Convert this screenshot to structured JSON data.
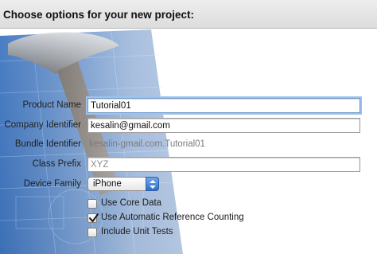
{
  "header": {
    "title": "Choose options for your new project:"
  },
  "form": {
    "product_name": {
      "label": "Product Name",
      "value": "Tutorial01"
    },
    "company_identifier": {
      "label": "Company Identifier",
      "value": "kesalin@gmail.com"
    },
    "bundle_identifier": {
      "label": "Bundle Identifier",
      "value": "kesalin-gmail.com.Tutorial01"
    },
    "class_prefix": {
      "label": "Class Prefix",
      "value": "XYZ"
    },
    "device_family": {
      "label": "Device Family",
      "selected": "iPhone"
    },
    "checkboxes": [
      {
        "label": "Use Core Data",
        "checked": false
      },
      {
        "label": "Use Automatic Reference Counting",
        "checked": true
      },
      {
        "label": "Include Unit Tests",
        "checked": false
      }
    ]
  },
  "colors": {
    "focus_ring": "#9fc2ea",
    "popup_accent": "#2f6fcc",
    "blueprint": "#3a6fb5"
  }
}
